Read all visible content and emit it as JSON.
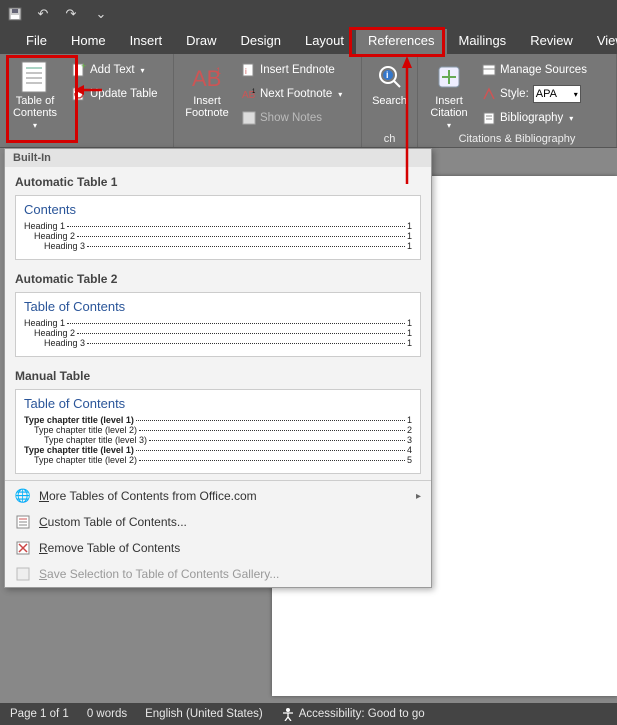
{
  "titlebar": {
    "save": "💾",
    "undo": "↶",
    "redo": "↷"
  },
  "tabs": [
    "File",
    "Home",
    "Insert",
    "Draw",
    "Design",
    "Layout",
    "References",
    "Mailings",
    "Review",
    "View"
  ],
  "active_tab_index": 6,
  "ribbon": {
    "toc": {
      "label": "Table of\nContents",
      "add_text": "Add Text",
      "update": "Update Table"
    },
    "footnotes": {
      "big": "Insert\nFootnote",
      "endnote": "Insert Endnote",
      "next": "Next Footnote",
      "show": "Show Notes",
      "group_label": ""
    },
    "search": {
      "label": "Search",
      "group_partial": "ch"
    },
    "citation": {
      "big": "Insert\nCitation",
      "manage": "Manage Sources",
      "style_label": "Style:",
      "style_value": "APA",
      "biblio": "Bibliography",
      "group_label": "Citations & Bibliography"
    }
  },
  "gallery": {
    "builtin_header": "Built-In",
    "options": [
      {
        "title": "Automatic Table 1",
        "preview_title": "Contents",
        "rows": [
          {
            "t": "Heading 1",
            "p": "1",
            "i": 0
          },
          {
            "t": "Heading 2",
            "p": "1",
            "i": 1
          },
          {
            "t": "Heading 3",
            "p": "1",
            "i": 2
          }
        ]
      },
      {
        "title": "Automatic Table 2",
        "preview_title": "Table of Contents",
        "rows": [
          {
            "t": "Heading 1",
            "p": "1",
            "i": 0
          },
          {
            "t": "Heading 2",
            "p": "1",
            "i": 1
          },
          {
            "t": "Heading 3",
            "p": "1",
            "i": 2
          }
        ]
      },
      {
        "title": "Manual Table",
        "preview_title": "Table of Contents",
        "rows": [
          {
            "t": "Type chapter title (level 1)",
            "p": "1",
            "i": 0,
            "b": true
          },
          {
            "t": "Type chapter title (level 2)",
            "p": "2",
            "i": 1
          },
          {
            "t": "Type chapter title (level 3)",
            "p": "3",
            "i": 2
          },
          {
            "t": "Type chapter title (level 1)",
            "p": "4",
            "i": 0,
            "b": true
          },
          {
            "t": "Type chapter title (level 2)",
            "p": "5",
            "i": 1
          }
        ]
      }
    ],
    "menu": {
      "more": "More Tables of Contents from Office.com",
      "custom": "Custom Table of Contents...",
      "remove": "Remove Table of Contents",
      "save_sel": "Save Selection to Table of Contents Gallery..."
    }
  },
  "status": {
    "page": "Page 1 of 1",
    "words": "0 words",
    "lang": "English (United States)",
    "acc": "Accessibility: Good to go"
  }
}
